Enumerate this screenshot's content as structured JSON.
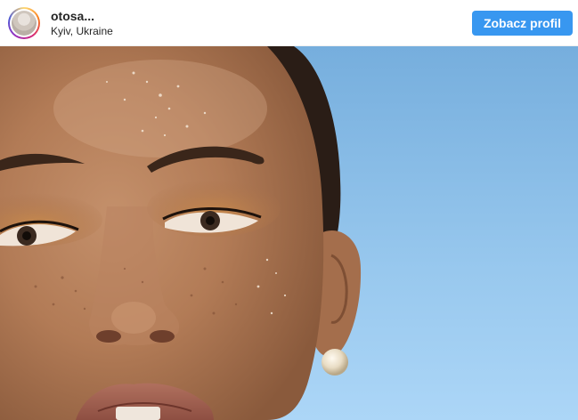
{
  "header": {
    "username": "otosa...",
    "location": "Kyiv, Ukraine",
    "view_profile_label": "Zobacz profil"
  },
  "photo": {
    "subject": "close-up portrait"
  },
  "colors": {
    "button": "#3897f0",
    "sky": "#9ccbf0",
    "skin": "#b07b58"
  }
}
